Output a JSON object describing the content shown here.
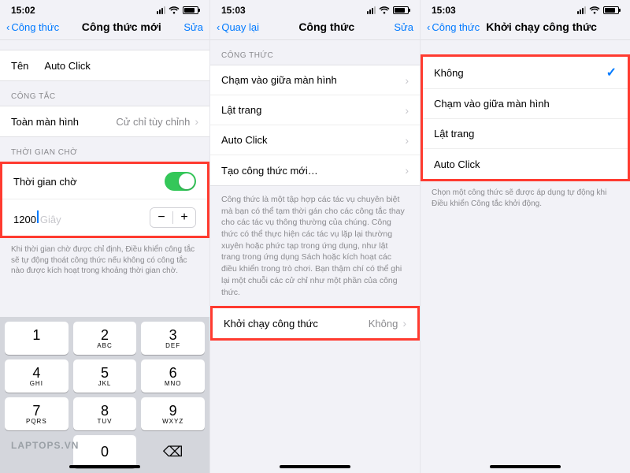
{
  "status": {
    "time1": "15:02",
    "time2": "15:03",
    "time3": "15:03"
  },
  "pane1": {
    "back": "Công thức",
    "title": "Công thức mới",
    "edit": "Sửa",
    "name_label": "Tên",
    "name_value": "Auto Click",
    "section_switch": "CÔNG TẮC",
    "switch_name": "Toàn màn hình",
    "switch_value": "Cử chỉ tùy chỉnh",
    "section_wait": "THỜI GIAN CHỜ",
    "wait_label": "Thời gian chờ",
    "wait_num": "1200",
    "wait_unit": "Giây",
    "wait_note": "Khi thời gian chờ được chỉ định, Điều khiển công tắc sẽ tự động thoát công thức nếu không có công tắc nào được kích hoạt trong khoảng thời gian chờ.",
    "keys": {
      "1": "1",
      "2": "2",
      "3": "3",
      "4": "4",
      "5": "5",
      "6": "6",
      "7": "7",
      "8": "8",
      "9": "9",
      "0": "0",
      "l2": "ABC",
      "l3": "DEF",
      "l4": "GHI",
      "l5": "JKL",
      "l6": "MNO",
      "l7": "PQRS",
      "l8": "TUV",
      "l9": "WXYZ"
    },
    "watermark": "LAPTOPS.VN"
  },
  "pane2": {
    "back": "Quay lại",
    "title": "Công thức",
    "edit": "Sửa",
    "section": "CÔNG THỨC",
    "items": [
      "Chạm vào giữa màn hình",
      "Lật trang",
      "Auto Click",
      "Tạo công thức mới…"
    ],
    "desc": "Công thức là một tập hợp các tác vụ chuyên biệt mà bạn có thể tạm thời gán cho các công tắc thay cho các tác vụ thông thường của chúng. Công thức có thể thực hiện các tác vụ lặp lại thường xuyên hoặc phức tạp trong ứng dụng, như lật trang trong ứng dụng Sách hoặc kích hoạt các điều khiển trong trò chơi. Bạn thậm chí có thể ghi lại một chuỗi các cử chỉ như một phần của công thức.",
    "launch_label": "Khởi chạy công thức",
    "launch_value": "Không"
  },
  "pane3": {
    "back": "Công thức",
    "title": "Khởi chạy công thức",
    "items": [
      "Không",
      "Chạm vào giữa màn hình",
      "Lật trang",
      "Auto Click"
    ],
    "selected": 0,
    "note": "Chọn một công thức sẽ được áp dụng tự động khi Điều khiển Công tắc khởi động."
  }
}
